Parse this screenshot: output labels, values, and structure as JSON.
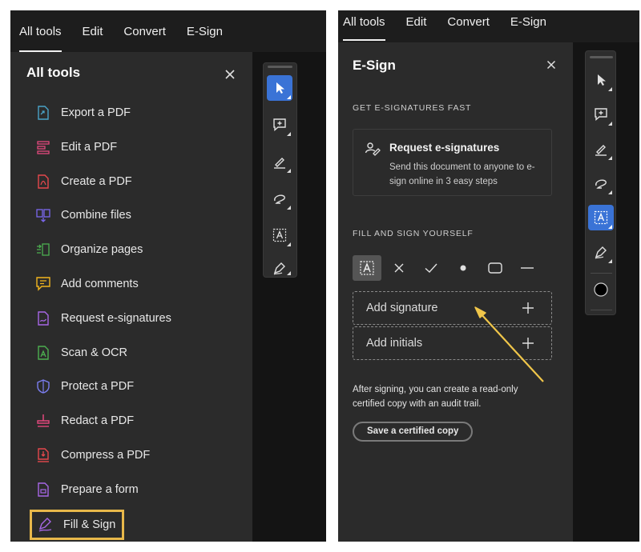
{
  "left_panel": {
    "nav": [
      "All tools",
      "Edit",
      "Convert",
      "E-Sign"
    ],
    "title": "All tools",
    "tools": [
      {
        "label": "Export a PDF",
        "icon": "export-pdf-icon",
        "color": "#4aa3c8"
      },
      {
        "label": "Edit a PDF",
        "icon": "edit-pdf-icon",
        "color": "#e2487c"
      },
      {
        "label": "Create a PDF",
        "icon": "create-pdf-icon",
        "color": "#e5484d"
      },
      {
        "label": "Combine files",
        "icon": "combine-files-icon",
        "color": "#7b68ee"
      },
      {
        "label": "Organize pages",
        "icon": "organize-pages-icon",
        "color": "#4caf50"
      },
      {
        "label": "Add comments",
        "icon": "add-comments-icon",
        "color": "#f2b51e"
      },
      {
        "label": "Request e-signatures",
        "icon": "request-esign-icon",
        "color": "#a767e6"
      },
      {
        "label": "Scan & OCR",
        "icon": "scan-ocr-icon",
        "color": "#4caf50"
      },
      {
        "label": "Protect a PDF",
        "icon": "protect-pdf-icon",
        "color": "#7b7ef0"
      },
      {
        "label": "Redact a PDF",
        "icon": "redact-pdf-icon",
        "color": "#e2487c"
      },
      {
        "label": "Compress a PDF",
        "icon": "compress-pdf-icon",
        "color": "#e5484d"
      },
      {
        "label": "Prepare a form",
        "icon": "prepare-form-icon",
        "color": "#a767e6"
      },
      {
        "label": "Fill & Sign",
        "icon": "fill-sign-icon",
        "color": "#a767e6"
      }
    ],
    "highlight_color": "#e8b84a"
  },
  "right_panel": {
    "nav": [
      "All tools",
      "Edit",
      "Convert",
      "E-Sign"
    ],
    "title": "E-Sign",
    "section1": "GET E-SIGNATURES FAST",
    "request_card": {
      "title": "Request e-signatures",
      "desc": "Send this document to anyone to e-sign online in 3 easy steps"
    },
    "section2": "FILL AND SIGN YOURSELF",
    "fill_tools": [
      "text-field-icon",
      "cross-icon",
      "checkmark-icon",
      "dot-icon",
      "rectangle-icon",
      "line-icon"
    ],
    "add_signature": "Add signature",
    "add_initials": "Add initials",
    "note": "After signing, you can create a read-only certified copy with an audit trail.",
    "certified_button": "Save a certified copy",
    "arrow_color": "#f0c64a"
  },
  "colors": {
    "accent_blue": "#3a73d6",
    "panel_bg": "#2b2b2b",
    "nav_bg": "#1d1d1d"
  }
}
